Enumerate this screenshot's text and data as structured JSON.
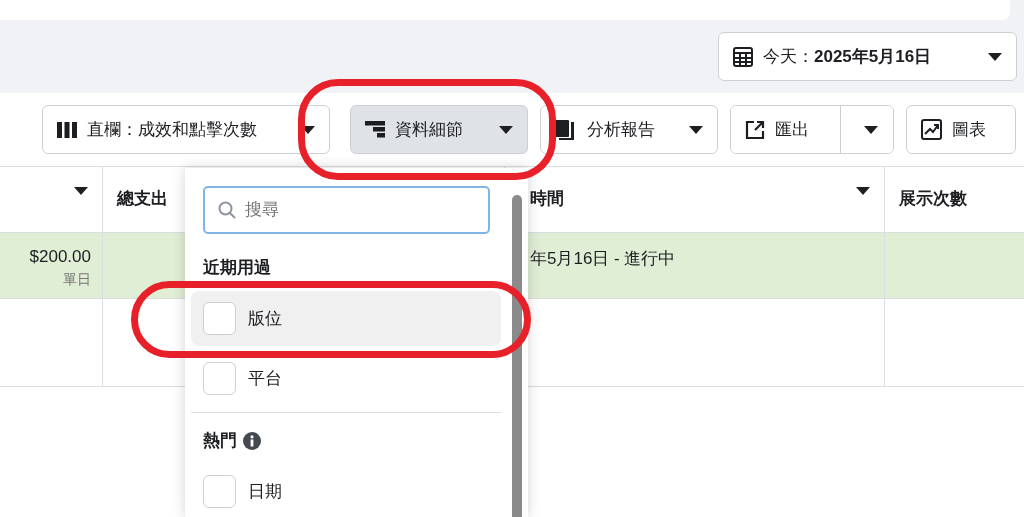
{
  "date_button": {
    "label": "今天：**2025年5月16日**"
  },
  "toolbar": [
    {
      "kind": "columns",
      "label": "直欄：成效和點擊次數",
      "selected": false,
      "ringed": false
    },
    {
      "kind": "breakdown",
      "label": "資料細節",
      "selected": true,
      "ringed": true
    },
    {
      "kind": "reports",
      "label": "分析報告",
      "selected": false,
      "ringed": false
    },
    {
      "kind": "export",
      "label": "匯出",
      "selected": false,
      "ringed": false
    },
    {
      "kind": "chart",
      "label": "圖表",
      "selected": false,
      "ringed": false
    }
  ],
  "table": {
    "columns": [
      {
        "sortable": true
      },
      {
        "label": "總支出"
      },
      {
        "label": "時間",
        "sortable": true
      },
      {
        "label": "展示次數",
        "sortable": false
      }
    ],
    "rows": [
      {
        "highlighted": true,
        "budget": "$200.00",
        "budget_note": "單日",
        "schedule": "年5月16日 - 進行中"
      },
      {
        "highlighted": false
      }
    ]
  },
  "dropdown": {
    "search": {
      "placeholder": "搜尋"
    },
    "sections": [
      {
        "title": "近期用過",
        "info": false,
        "items": [
          {
            "label": "版位",
            "checked": false,
            "hovered": true,
            "ringed": true
          },
          {
            "label": "平台",
            "checked": false,
            "hovered": false,
            "ringed": false
          }
        ]
      },
      {
        "title": "熱門",
        "info": true,
        "items": [
          {
            "label": "日期",
            "checked": false,
            "hovered": false,
            "ringed": false
          }
        ]
      }
    ]
  }
}
